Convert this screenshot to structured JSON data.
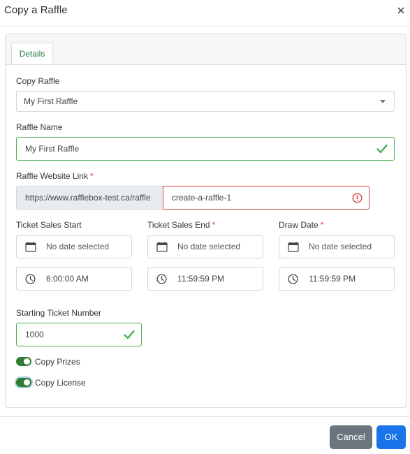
{
  "dialog": {
    "title": "Copy a Raffle"
  },
  "tabs": [
    {
      "label": "Details"
    }
  ],
  "copy_raffle": {
    "label": "Copy Raffle",
    "value": "My First Raffle"
  },
  "raffle_name": {
    "label": "Raffle Name",
    "value": "My First Raffle"
  },
  "website_link": {
    "label": "Raffle Website Link",
    "required_mark": "*",
    "prefix": "https://www.rafflebox-test.ca/raffle",
    "value": "create-a-raffle-1"
  },
  "ticket_sales_start": {
    "label": "Ticket Sales Start",
    "date_placeholder": "No date selected",
    "time": "6:00:00 AM"
  },
  "ticket_sales_end": {
    "label": "Ticket Sales End",
    "required_mark": "*",
    "date_placeholder": "No date selected",
    "time": "11:59:59 PM"
  },
  "draw_date": {
    "label": "Draw Date",
    "required_mark": "*",
    "date_placeholder": "No date selected",
    "time": "11:59:59 PM"
  },
  "starting_ticket": {
    "label": "Starting Ticket Number",
    "value": "1000"
  },
  "toggles": [
    {
      "label": "Copy Prizes",
      "checked": true
    },
    {
      "label": "Copy License",
      "checked": true
    }
  ],
  "buttons": {
    "cancel": "Cancel",
    "ok": "OK"
  },
  "colors": {
    "valid": "#4caf50",
    "invalid": "#d64545",
    "primary": "#1a73e8",
    "secondary": "#6c757d",
    "toggle": "#2e7d32",
    "tab_text": "#1f7a3f"
  },
  "icons": [
    "close-icon",
    "caret-down-icon",
    "check-icon",
    "error-icon",
    "calendar-icon",
    "clock-icon"
  ]
}
